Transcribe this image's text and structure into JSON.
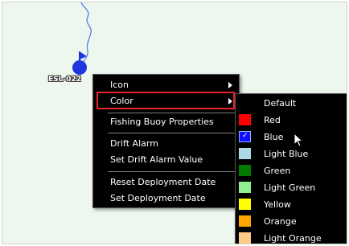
{
  "buoy": {
    "label": "ESL-022",
    "track_color": "#3a5ae8",
    "marker_color": "#1f35e0"
  },
  "context_menu": {
    "items": [
      {
        "label": "Icon",
        "submenu": true
      },
      {
        "label": "Color",
        "submenu": true,
        "highlighted": true
      },
      {
        "label": "Fishing Buoy Properties",
        "submenu": false
      },
      {
        "label": "Drift Alarm",
        "submenu": false
      },
      {
        "label": "Set Drift Alarm Value",
        "submenu": false
      },
      {
        "label": "Reset Deployment Date",
        "submenu": false
      },
      {
        "label": "Set Deployment Date",
        "submenu": false
      }
    ]
  },
  "color_menu": {
    "items": [
      {
        "label": "Default",
        "swatch": null
      },
      {
        "label": "Red",
        "swatch": "#ff0000"
      },
      {
        "label": "Blue",
        "swatch": "#1010ff",
        "selected": true
      },
      {
        "label": "Light Blue",
        "swatch": "#add8e6"
      },
      {
        "label": "Green",
        "swatch": "#007a00"
      },
      {
        "label": "Light Green",
        "swatch": "#90ee90"
      },
      {
        "label": "Yellow",
        "swatch": "#ffff00"
      },
      {
        "label": "Orange",
        "swatch": "#ffa500"
      },
      {
        "label": "Light Orange",
        "swatch": "#ffc987"
      }
    ]
  },
  "colors": {
    "map_background": "#eef7ee",
    "menu_background": "#000000",
    "highlight_border": "#e8232b"
  },
  "icons": {
    "buoy": "buoy-icon",
    "submenu_arrow": "chevron-right-icon",
    "cursor": "mouse-pointer-icon",
    "check": "check-icon"
  }
}
